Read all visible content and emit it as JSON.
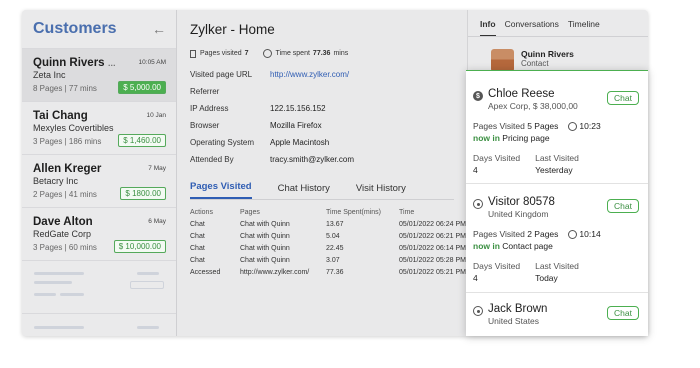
{
  "sidebar": {
    "title": "Customers",
    "customers": [
      {
        "name": "Quinn Rivers",
        "org": "Zeta Inc",
        "meta": "8 Pages | 77 mins",
        "time": "10:05 AM",
        "amount": "$ 5,000.00",
        "typing": "…"
      },
      {
        "name": "Tai Chang",
        "org": "Mexyles Covertibles",
        "meta": "3 Pages | 186 mins",
        "time": "10 Jan",
        "amount": "$ 1,460.00"
      },
      {
        "name": "Allen Kreger",
        "org": "Betacry Inc",
        "meta": "2 Pages | 41 mins",
        "time": "7 May",
        "amount": "$ 1800.00"
      },
      {
        "name": "Dave Alton",
        "org": "RedGate Corp",
        "meta": "3 Pages | 60 mins",
        "time": "6 May",
        "amount": "$ 10,000.00"
      }
    ]
  },
  "main": {
    "title": "Zylker - Home",
    "pages_visited_label": "Pages visited",
    "pages_visited_value": "7",
    "time_spent_label": "Time spent",
    "time_spent_value": "77.36",
    "time_spent_unit": "mins",
    "info": [
      {
        "key": "Visited page URL",
        "value": "http://www.zylker.com/"
      },
      {
        "key": "Referrer",
        "value": ""
      },
      {
        "key": "IP Address",
        "value": "122.15.156.152"
      },
      {
        "key": "Browser",
        "value": "Mozilla Firefox"
      },
      {
        "key": "Operating System",
        "value": "Apple Macintosh"
      },
      {
        "key": "Attended By",
        "value": "tracy.smith@zylker.com"
      }
    ],
    "tabs": [
      "Pages Visited",
      "Chat History",
      "Visit History"
    ],
    "table_headers": [
      "Actions",
      "Pages",
      "Time Spent(mins)",
      "Time"
    ],
    "table_rows": [
      [
        "Chat",
        "Chat with Quinn",
        "13.67",
        "05/01/2022 06:24 PM"
      ],
      [
        "Chat",
        "Chat with Quinn",
        "5.04",
        "05/01/2022 06:21 PM"
      ],
      [
        "Chat",
        "Chat with Quinn",
        "22.45",
        "05/01/2022 06:14 PM"
      ],
      [
        "Chat",
        "Chat with Quinn",
        "3.07",
        "05/01/2022 05:28 PM"
      ],
      [
        "Accessed",
        "http://www.zylker.com/",
        "77.36",
        "05/01/2022 05:21 PM"
      ]
    ]
  },
  "right": {
    "tabs": [
      "Info",
      "Conversations",
      "Timeline"
    ],
    "contact_name": "Quinn Rivers",
    "contact_role": "Contact"
  },
  "popup": {
    "visitors": [
      {
        "name": "Chloe Reese",
        "sub": "Apex Corp, $ 38,000,00",
        "icon": "dollar-icon",
        "pages_label": "Pages Visited",
        "pages": "5 Pages",
        "time": "10:23",
        "now_prefix": "now in",
        "now_page": "Pricing page",
        "days_label": "Days Visited",
        "days": "4",
        "last_label": "Last Visited",
        "last": "Yesterday",
        "chat": "Chat"
      },
      {
        "name": "Visitor 80578",
        "sub": "United Kingdom",
        "icon": "eye-icon",
        "pages_label": "Pages Visited",
        "pages": "2 Pages",
        "time": "10:14",
        "now_prefix": "now in",
        "now_page": "Contact page",
        "days_label": "Days Visited",
        "days": "4",
        "last_label": "Last Visited",
        "last": "Today",
        "chat": "Chat"
      },
      {
        "name": "Jack Brown",
        "sub": "United States",
        "icon": "eye-icon",
        "chat": "Chat"
      }
    ]
  },
  "colors": {
    "accent": "#2f5db3",
    "green": "#4caf50"
  }
}
